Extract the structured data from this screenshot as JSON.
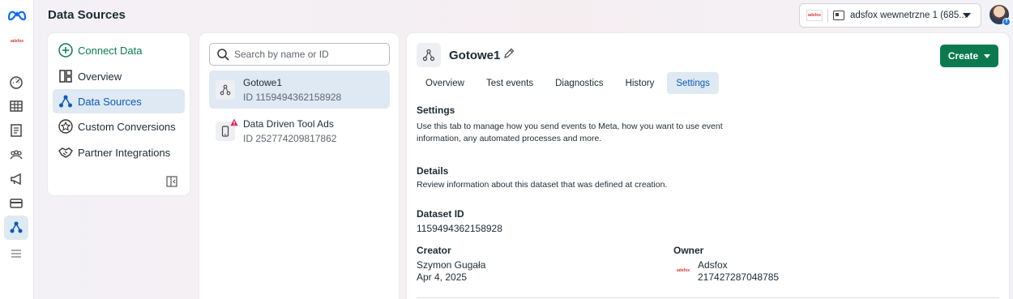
{
  "app": {
    "brand_colors": {
      "accent_blue": "#0a5bba",
      "create_green": "#0a7a4e",
      "selected_bg": "#dfe9f3"
    }
  },
  "header": {
    "title": "Data Sources",
    "account_picker": {
      "label": "adsfox wewnetrzne 1 (685...",
      "logo_text": "adsfox"
    }
  },
  "rail": {
    "account_logo_text": "adsfox",
    "icons": [
      "meta-logo",
      "dashboard-icon",
      "table-icon",
      "catalog-icon",
      "audience-icon",
      "megaphone-icon",
      "billing-icon",
      "data-sources-icon",
      "menu-icon"
    ]
  },
  "nav": {
    "items": [
      {
        "label": "Connect Data",
        "icon": "plus-circle-icon"
      },
      {
        "label": "Overview",
        "icon": "overview-icon"
      },
      {
        "label": "Data Sources",
        "icon": "data-sources-icon",
        "active": true
      },
      {
        "label": "Custom Conversions",
        "icon": "star-badge-icon"
      },
      {
        "label": "Partner Integrations",
        "icon": "handshake-icon"
      }
    ]
  },
  "list": {
    "search_placeholder": "Search by name or ID",
    "items": [
      {
        "name": "Gotowe1",
        "id": "ID 1159494362158928",
        "selected": true,
        "icon": "dataset-icon"
      },
      {
        "name": "Data Driven Tool Ads",
        "id": "ID 252774209817862",
        "warning": true,
        "icon": "mobile-app-icon"
      }
    ]
  },
  "detail": {
    "title": "Gotowe1",
    "create_label": "Create",
    "tabs": [
      "Overview",
      "Test events",
      "Diagnostics",
      "History",
      "Settings"
    ],
    "active_tab": "Settings",
    "settings": {
      "heading": "Settings",
      "desc_line1": "Use this tab to manage how you send events to Meta, how you want to use event",
      "desc_line2": "information, any automated processes and more."
    },
    "details": {
      "heading": "Details",
      "desc": "Review information about this dataset that was defined at creation."
    },
    "dataset_id": {
      "label": "Dataset ID",
      "value": "1159494362158928"
    },
    "creator": {
      "label": "Creator",
      "name": "Szymon Gugała",
      "date": "Apr 4, 2025"
    },
    "owner": {
      "label": "Owner",
      "name": "Adsfox",
      "id": "217427287048785",
      "logo_text": "adsfox"
    }
  }
}
